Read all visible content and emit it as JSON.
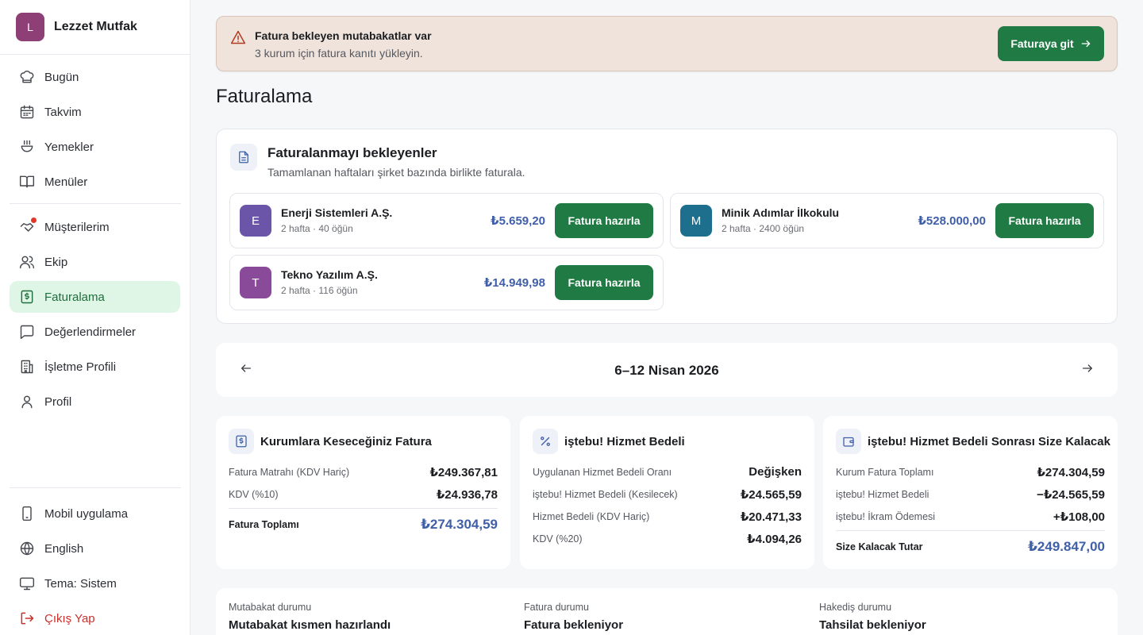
{
  "brand": {
    "initial": "L",
    "name": "Lezzet Mutfak",
    "color": "#8e3f75"
  },
  "nav": {
    "today": "Bugün",
    "calendar": "Takvim",
    "meals": "Yemekler",
    "menus": "Menüler",
    "customers": "Müşterilerim",
    "team": "Ekip",
    "billing": "Faturalama",
    "reviews": "Değerlendirmeler",
    "business_profile": "İşletme Profili",
    "profile": "Profil",
    "mobile_app": "Mobil uygulama",
    "language": "English",
    "theme": "Tema: Sistem",
    "logout": "Çıkış Yap"
  },
  "alert": {
    "title": "Fatura bekleyen mutabakatlar var",
    "subtitle": "3 kurum için fatura kanıtı yükleyin.",
    "button": "Faturaya git"
  },
  "page_title": "Faturalama",
  "pending": {
    "title": "Faturalanmayı bekleyenler",
    "subtitle": "Tamamlanan haftaları şirket bazında birlikte faturala.",
    "button_label": "Fatura hazırla",
    "items": [
      {
        "initial": "E",
        "name": "Enerji Sistemleri A.Ş.",
        "meta": "2 hafta · 40 öğün",
        "amount": "₺5.659,20",
        "color": "#6b55a8"
      },
      {
        "initial": "M",
        "name": "Minik Adımlar İlkokulu",
        "meta": "2 hafta · 2400 öğün",
        "amount": "₺528.000,00",
        "color": "#1e6f8e"
      },
      {
        "initial": "T",
        "name": "Tekno Yazılım A.Ş.",
        "meta": "2 hafta · 116 öğün",
        "amount": "₺14.949,98",
        "color": "#8a4a9a"
      }
    ]
  },
  "week": {
    "label": "6–12 Nisan 2026"
  },
  "summary": {
    "invoice": {
      "title": "Kurumlara Keseceğiniz Fatura",
      "rows": [
        {
          "label": "Fatura Matrahı (KDV Hariç)",
          "value": "₺249.367,81"
        },
        {
          "label": "KDV (%10)",
          "value": "₺24.936,78"
        }
      ],
      "total_label": "Fatura Toplamı",
      "total_value": "₺274.304,59"
    },
    "service": {
      "title": "iştebu! Hizmet Bedeli",
      "rows": [
        {
          "label": "Uygulanan Hizmet Bedeli Oranı",
          "value": "Değişken"
        },
        {
          "label": "iştebu! Hizmet Bedeli (Kesilecek)",
          "value": "₺24.565,59"
        },
        {
          "label": "Hizmet Bedeli (KDV Hariç)",
          "value": "₺20.471,33"
        },
        {
          "label": "KDV (%20)",
          "value": "₺4.094,26"
        }
      ]
    },
    "remaining": {
      "title": "iştebu! Hizmet Bedeli Sonrası Size Kalacak",
      "rows": [
        {
          "label": "Kurum Fatura Toplamı",
          "value": "₺274.304,59"
        },
        {
          "label": "iştebu! Hizmet Bedeli",
          "value": "−₺24.565,59"
        },
        {
          "label": "iştebu! İkram Ödemesi",
          "value": "+₺108,00"
        }
      ],
      "total_label": "Size Kalacak Tutar",
      "total_value": "₺249.847,00"
    }
  },
  "status": {
    "reconciliation_label": "Mutabakat durumu",
    "reconciliation_value": "Mutabakat kısmen hazırlandı",
    "invoice_label": "Fatura durumu",
    "invoice_value": "Fatura bekleniyor",
    "payment_label": "Hakediş durumu",
    "payment_value": "Tahsilat bekleniyor"
  },
  "colors": {
    "accent_green": "#1f7a43",
    "amount_blue": "#3f5fa8",
    "active_bg": "#dff5e6",
    "logout_red": "#c9302c"
  }
}
